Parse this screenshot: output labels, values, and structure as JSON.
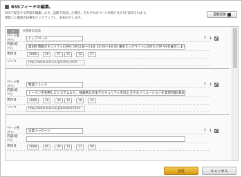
{
  "dialog": {
    "title": "RSSフィードの編集。",
    "desc_line1": "RSSで配信する内容を編集します。自動で追加した場合、それぞれのページの紹介文が1行表示されます。",
    "desc_line2": "更新した最新の記事をピックアップし、お知らせします。",
    "auto_add_label": "自動追加"
  },
  "add_row": {
    "button_symbol": "＋",
    "label": "※項目の追加"
  },
  "labels": {
    "page_name": "ページ名",
    "page_name_sub": "(件名)",
    "content": "内容(紹",
    "content_sub": "介文)",
    "updated": "更新日",
    "link": "リンク"
  },
  "entries": [
    {
      "name": "トップページ",
      "content": "第6回 情報セキュリティEXPO 5月11日〜13日 10:00〜18:00 東京ビッグサイトにNITS OTP VSを展示します",
      "date": {
        "year": "2008",
        "month": "10",
        "day": "27",
        "hour": "11",
        "min": "12",
        "sec": "27"
      },
      "link": "http://www.arai.co.jp/index.html"
    },
    {
      "name": "製品ニュース",
      "content": "トークンを利用したシステムより、低価格な方法でセキュリティを向上させるソリューションを実現可能(基本)",
      "date": {
        "year": "2008",
        "month": "10",
        "day": "30",
        "hour": "15",
        "min": "10",
        "sec": "34"
      },
      "link": "http://www.arai.co.jp/product.html"
    },
    {
      "name": "企業メッセージ",
      "content": "",
      "date": {
        "year": "2008",
        "month": "05",
        "day": "30",
        "hour": "15",
        "min": "17",
        "sec": "09"
      },
      "link": ""
    }
  ],
  "footer": {
    "ok_label": "決定",
    "cancel_label": "キャンセル"
  },
  "icons": {
    "move_up": "↑",
    "move_down": "↓"
  },
  "colors": {
    "ok_button": "#e0a92a",
    "cancel_button": "#e6e6e6"
  }
}
